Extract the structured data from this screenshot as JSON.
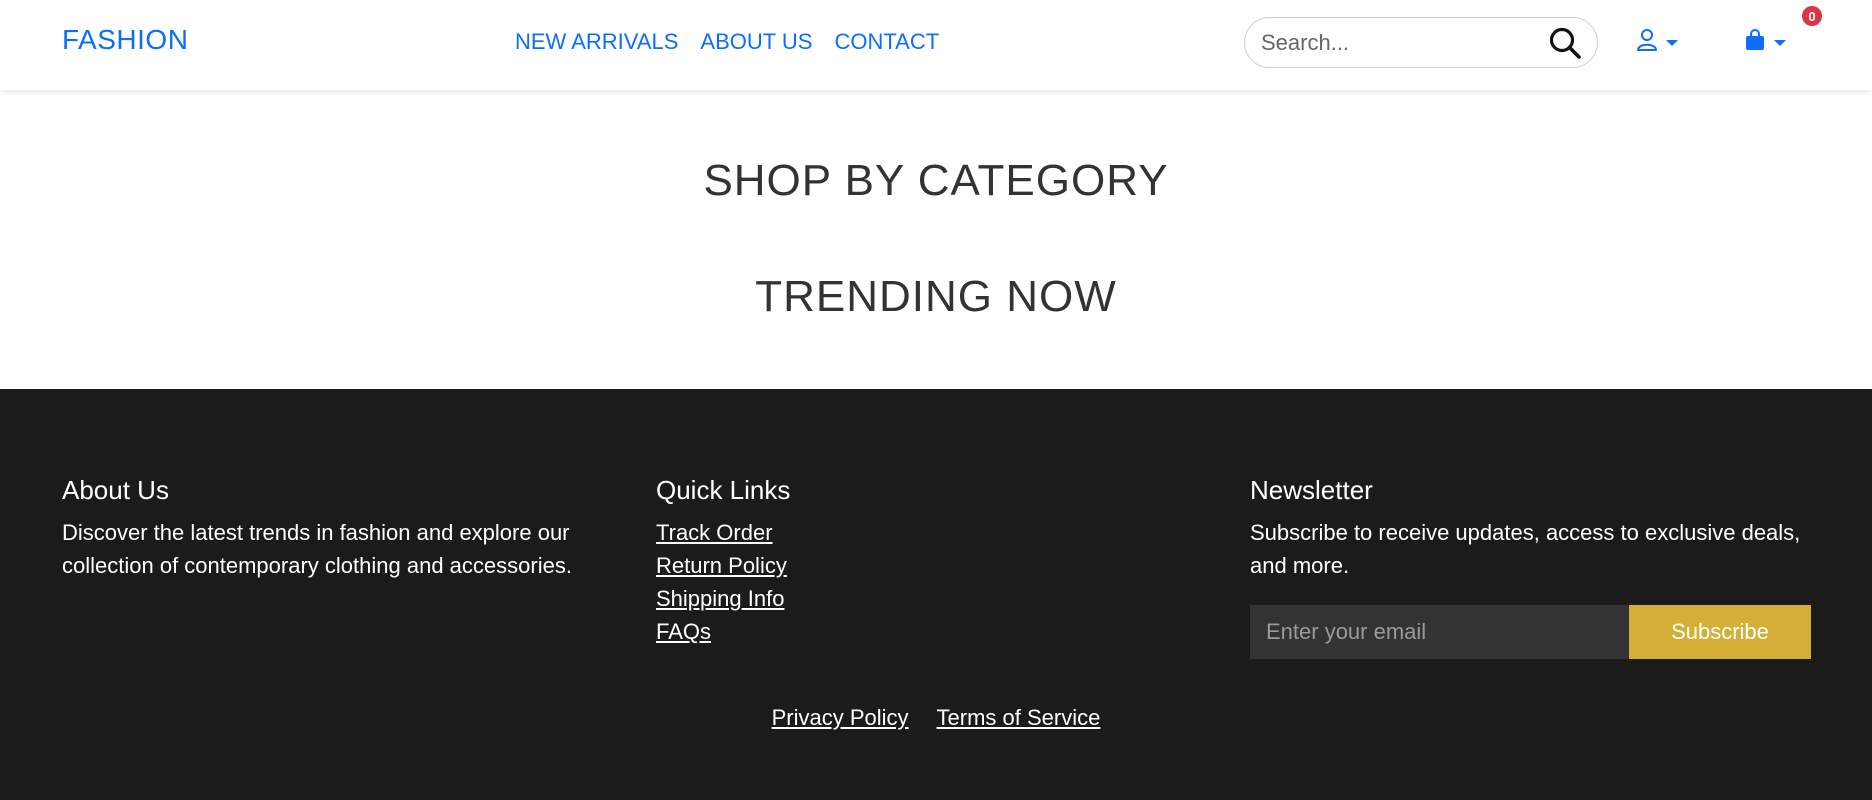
{
  "header": {
    "logo": "FASHION",
    "nav": [
      {
        "label": "NEW ARRIVALS"
      },
      {
        "label": "ABOUT US"
      },
      {
        "label": "CONTACT"
      }
    ],
    "search": {
      "placeholder": "Search...",
      "icon": "search-icon"
    },
    "user_icon": "user-icon",
    "cart_icon": "shopping-bag-icon",
    "cart_count": "0",
    "accent_color": "#0d6efd",
    "badge_color": "#dc3545"
  },
  "main": {
    "section1_title": "SHOP BY CATEGORY",
    "section2_title": "TRENDING NOW"
  },
  "footer": {
    "background": "#1b1b1b",
    "about": {
      "title": "About Us",
      "text": "Discover the latest trends in fashion and explore our collection of contemporary clothing and accessories."
    },
    "quick_links": {
      "title": "Quick Links",
      "items": [
        "Track Order",
        "Return Policy",
        "Shipping Info",
        "FAQs"
      ]
    },
    "newsletter": {
      "title": "Newsletter",
      "text": "Subscribe to receive updates, access to exclusive deals, and more.",
      "placeholder": "Enter your email",
      "button": "Subscribe",
      "button_color": "#d4af37"
    },
    "legal": [
      "Privacy Policy",
      "Terms of Service"
    ]
  }
}
